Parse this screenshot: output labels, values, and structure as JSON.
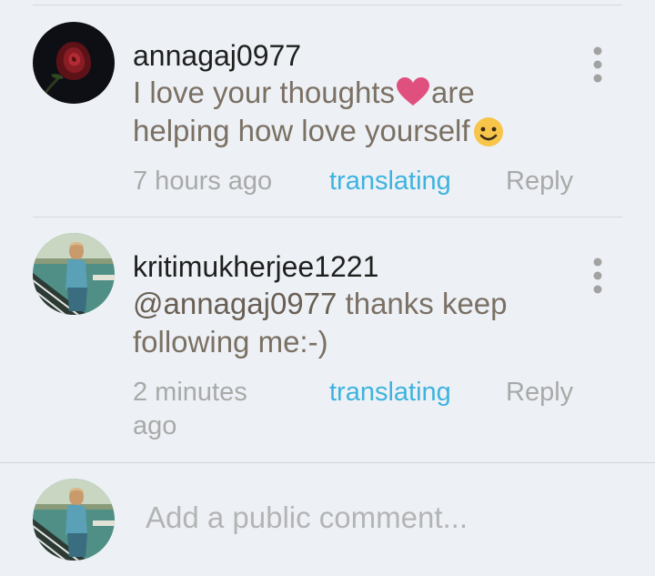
{
  "comments": [
    {
      "username": "annagaj0977",
      "text_part1": "I love your thoughts",
      "text_part2": "are helping how love yourself",
      "time": "7 hours ago",
      "translate_label": "translating",
      "reply_label": "Reply"
    },
    {
      "username": "kritimukherjee1221",
      "mention": "@annagaj0977",
      "text": " thanks keep following me:-)",
      "time": "2 minutes ago",
      "translate_label": "translating",
      "reply_label": "Reply"
    }
  ],
  "compose": {
    "placeholder": "Add a public comment..."
  },
  "icons": {
    "avatar_1": "red-rose-avatar",
    "avatar_2": "woman-tennis-court-avatar",
    "heart_emoji": "heart-emoji",
    "smile_emoji": "smiling-face-emoji",
    "menu": "more-vertical-icon"
  },
  "colors": {
    "link": "#3eb3df",
    "heart": "#e0507f",
    "username": "#1f1f1f",
    "comment_text": "#7b7064",
    "meta_text": "#a9a9a9"
  }
}
